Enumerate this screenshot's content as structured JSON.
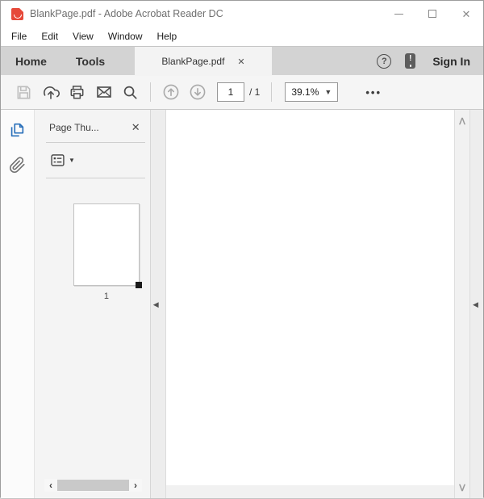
{
  "titlebar": {
    "title": "BlankPage.pdf - Adobe Acrobat Reader DC"
  },
  "menubar": {
    "items": [
      "File",
      "Edit",
      "View",
      "Window",
      "Help"
    ]
  },
  "tabbar": {
    "home_label": "Home",
    "tools_label": "Tools",
    "document_tab_label": "BlankPage.pdf",
    "sign_in_label": "Sign In"
  },
  "toolbar": {
    "page_number_value": "1",
    "page_total_label": "/ 1",
    "zoom_value": "39.1%"
  },
  "sidebar": {
    "panel_title": "Page Thu...",
    "page_thumbnail_label": "1"
  },
  "colors": {
    "accent_blue": "#2a70ba",
    "acrobat_red": "#e6493a",
    "toolbar_bg": "#f5f5f5",
    "tabbar_bg": "#d3d3d3"
  },
  "icons": {
    "minimize": "",
    "maximize": "",
    "close": "✕",
    "tab_close": "✕",
    "help": "?",
    "exclamation": "!",
    "dropdown": "▼",
    "options_dropdown": "▼",
    "more_tools": "•••",
    "scroll_left": "‹",
    "scroll_right": "›",
    "scroll_up": "ᐱ",
    "scroll_down": "ᐯ",
    "collapse_left": "◀"
  }
}
